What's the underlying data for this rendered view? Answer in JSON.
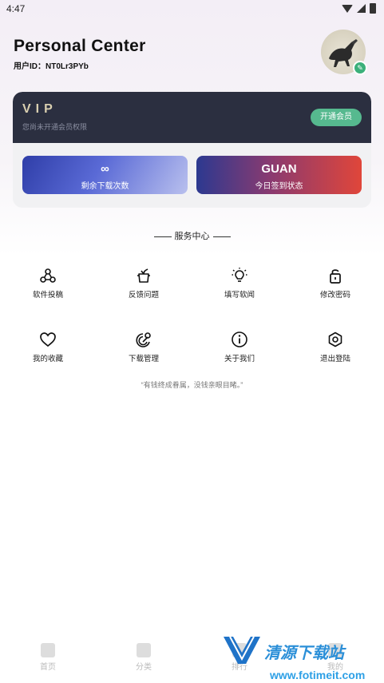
{
  "status": {
    "time": "4:47"
  },
  "header": {
    "title": "Personal Center",
    "user_id": "用户ID：NT0Lr3PYb"
  },
  "vip": {
    "title": "VIP",
    "subtitle": "您尚未开通会员权限",
    "button": "开通会员",
    "cards": [
      {
        "value": "∞",
        "label": "剩余下载次数"
      },
      {
        "value": "GUAN",
        "label": "今日签到状态"
      }
    ]
  },
  "services": {
    "title": "服务中心",
    "items": [
      {
        "label": "软件投稿",
        "icon": "share-nodes-icon"
      },
      {
        "label": "反馈问题",
        "icon": "feedback-icon"
      },
      {
        "label": "填写软闻",
        "icon": "lightbulb-icon"
      },
      {
        "label": "修改密码",
        "icon": "lock-icon"
      },
      {
        "label": "我的收藏",
        "icon": "heart-icon"
      },
      {
        "label": "下载管理",
        "icon": "download-manager-icon"
      },
      {
        "label": "关于我们",
        "icon": "info-icon"
      },
      {
        "label": "退出登陆",
        "icon": "logout-icon"
      }
    ]
  },
  "quote": "“有钱终成眷属，没钱亲眼目睹。”",
  "nav": {
    "tabs": [
      "首页",
      "分类",
      "排行",
      "我的"
    ]
  },
  "watermark": {
    "title": "清源下载站",
    "url": "www.fotimeit.com"
  }
}
